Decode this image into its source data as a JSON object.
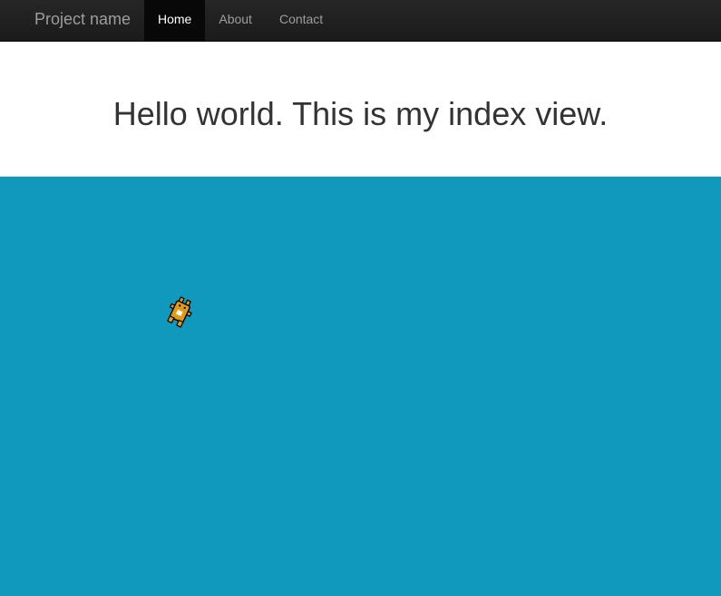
{
  "navbar": {
    "brand": "Project name",
    "items": [
      {
        "label": "Home",
        "active": true
      },
      {
        "label": "About",
        "active": false
      },
      {
        "label": "Contact",
        "active": false
      }
    ]
  },
  "main": {
    "heading": "Hello world. This is my index view."
  },
  "game": {
    "background_color": "#1099bd",
    "sprite_icon": "bear-sprite-icon",
    "sprite_color": "#e39b16"
  }
}
